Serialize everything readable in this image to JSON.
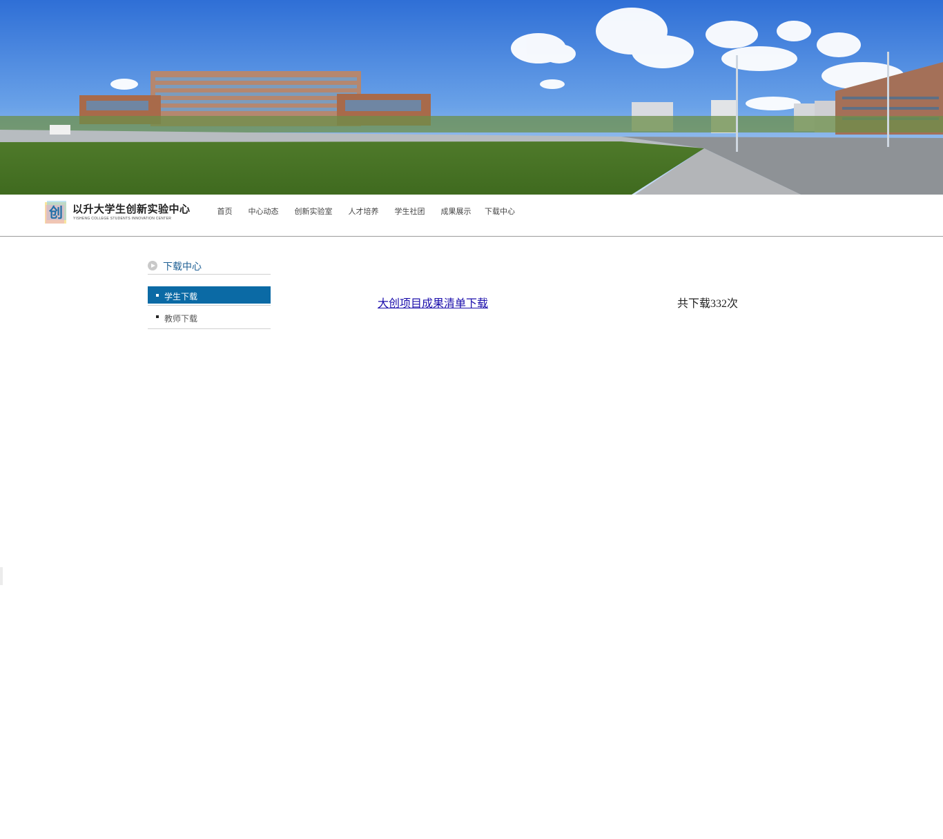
{
  "header": {
    "logo_title": "以升大学生创新实验中心",
    "logo_subtitle": "YISHENG COLLEGE STUDENTS INNOVATION CENTER",
    "logo_glyph": "创"
  },
  "nav": {
    "items": [
      {
        "label": "首页"
      },
      {
        "label": "中心动态"
      },
      {
        "label": "创新实验室"
      },
      {
        "label": "人才培养"
      },
      {
        "label": "学生社团"
      },
      {
        "label": "成果展示"
      },
      {
        "label": "下载中心"
      }
    ]
  },
  "sidebar": {
    "title": "下载中心",
    "items": [
      {
        "label": "学生下载",
        "active": true
      },
      {
        "label": "教师下载",
        "active": false
      }
    ]
  },
  "downloads": {
    "rows": [
      {
        "title": "大创项目成果清单下载",
        "count_text": "共下载332次"
      }
    ]
  },
  "colors": {
    "accent": "#0b6aa5",
    "sidebar_title": "#1c5e93",
    "link": "#1a0dab"
  }
}
